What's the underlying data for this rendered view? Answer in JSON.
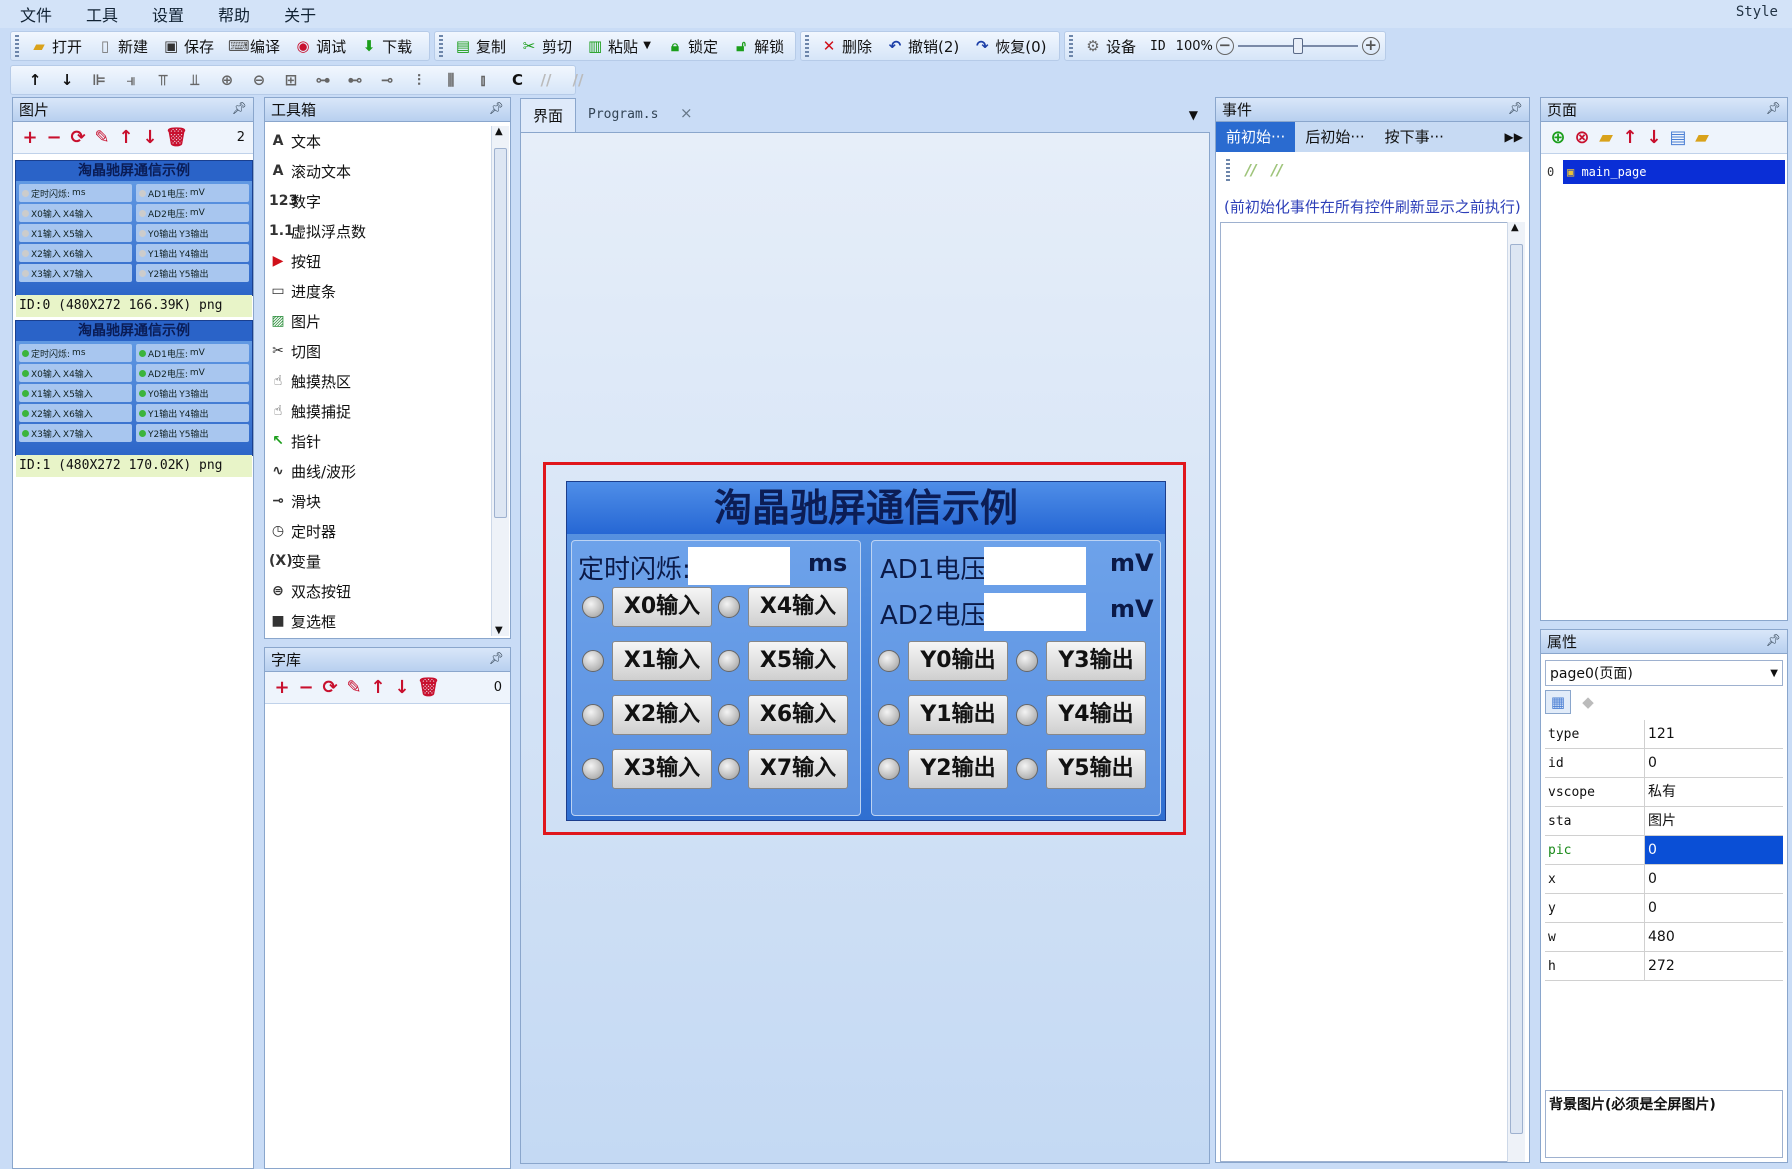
{
  "menu": {
    "items": [
      "文件",
      "工具",
      "设置",
      "帮助",
      "关于"
    ],
    "style": "Style"
  },
  "toolbar1": {
    "file": [
      {
        "icon": "open-folder-icon",
        "label": "打开"
      },
      {
        "icon": "new-file-icon",
        "label": "新建"
      },
      {
        "icon": "save-icon",
        "label": "保存"
      },
      {
        "icon": "compile-icon",
        "label": "编译"
      },
      {
        "icon": "debug-icon",
        "label": "调试"
      },
      {
        "icon": "download-icon",
        "label": "下载"
      }
    ],
    "edit": [
      {
        "icon": "copy-icon",
        "label": "复制"
      },
      {
        "icon": "cut-icon",
        "label": "剪切"
      },
      {
        "icon": "paste-icon",
        "label": "粘贴"
      },
      {
        "icon": "lock-icon",
        "label": "锁定"
      },
      {
        "icon": "unlock-icon",
        "label": "解锁"
      }
    ],
    "history": [
      {
        "icon": "delete-icon",
        "label": "删除"
      },
      {
        "icon": "undo-icon",
        "label": "撤销(2)"
      },
      {
        "icon": "redo-icon",
        "label": "恢复(0)"
      }
    ],
    "device_label": "设备",
    "id_label": "ID",
    "zoom": "100%",
    "zoom_level": 0.5
  },
  "toolbar2": {
    "extra": "C"
  },
  "pictures_panel": {
    "title": "图片",
    "count": "2",
    "items": [
      {
        "title": "淘晶驰屏通信示例",
        "info": "ID:0  (480X272 166.39K) png",
        "active": false
      },
      {
        "title": "淘晶驰屏通信示例",
        "info": "ID:1  (480X272 170.02K) png",
        "active": true
      }
    ],
    "mini_labels": [
      "定时闪烁:",
      "ms",
      "AD1电压:",
      "mV",
      "X0输入",
      "X4输入",
      "AD2电压:",
      "mV",
      "X1输入",
      "X5输入",
      "Y0输出",
      "Y3输出",
      "X2输入",
      "X6输入",
      "Y1输出",
      "Y4输出",
      "X3输入",
      "X7输入",
      "Y2输出",
      "Y5输出"
    ]
  },
  "toolbox": {
    "title": "工具箱",
    "items": [
      {
        "icon": "text-icon",
        "glyph": "A",
        "label": "文本"
      },
      {
        "icon": "scroll-text-icon",
        "glyph": "A",
        "label": "滚动文本"
      },
      {
        "icon": "number-icon",
        "glyph": "123",
        "label": "数字"
      },
      {
        "icon": "float-icon",
        "glyph": "1.1",
        "label": "虚拟浮点数"
      },
      {
        "icon": "button-icon",
        "glyph": "▶",
        "label": "按钮"
      },
      {
        "icon": "progress-icon",
        "glyph": "▭",
        "label": "进度条"
      },
      {
        "icon": "picture-icon",
        "glyph": "▨",
        "label": "图片"
      },
      {
        "icon": "crop-icon",
        "glyph": "✂",
        "label": "切图"
      },
      {
        "icon": "hotspot-icon",
        "glyph": "☝",
        "label": "触摸热区"
      },
      {
        "icon": "touch-capture-icon",
        "glyph": "☝",
        "label": "触摸捕捉"
      },
      {
        "icon": "pointer-icon",
        "glyph": "↖",
        "label": "指针"
      },
      {
        "icon": "waveform-icon",
        "glyph": "∿",
        "label": "曲线/波形"
      },
      {
        "icon": "slider-icon",
        "glyph": "⊸",
        "label": "滑块"
      },
      {
        "icon": "timer-icon",
        "glyph": "◷",
        "label": "定时器"
      },
      {
        "icon": "variable-icon",
        "glyph": "(X)",
        "label": "变量"
      },
      {
        "icon": "dual-state-icon",
        "glyph": "⊜",
        "label": "双态按钮"
      },
      {
        "icon": "checkbox-icon",
        "glyph": "■",
        "label": "复选框"
      }
    ]
  },
  "fonts_panel": {
    "title": "字库",
    "count": "0"
  },
  "editor": {
    "tabs": [
      "界面",
      "Program.s"
    ],
    "close": "×",
    "hmi": {
      "title": "淘晶驰屏通信示例",
      "blink_label": "定时闪烁:",
      "blink_unit": "ms",
      "ad1_label": "AD1电压:",
      "ad2_label": "AD2电压:",
      "volt_unit": "mV",
      "inputs": [
        "X0输入",
        "X4输入",
        "X1输入",
        "X5输入",
        "X2输入",
        "X6输入",
        "X3输入",
        "X7输入"
      ],
      "outputs": [
        "Y0输出",
        "Y3输出",
        "Y1输出",
        "Y4输出",
        "Y2输出",
        "Y5输出"
      ]
    }
  },
  "events_panel": {
    "title": "事件",
    "tabs": [
      "前初始···",
      "后初始···",
      "按下事···"
    ],
    "note": "(前初始化事件在所有控件刷新显示之前执行)"
  },
  "pages_panel": {
    "title": "页面",
    "index": "0",
    "page": "main_page"
  },
  "props_panel": {
    "title": "属性",
    "selector": "page0(页面)",
    "rows": [
      {
        "k": "type",
        "v": "121"
      },
      {
        "k": "id",
        "v": "0"
      },
      {
        "k": "vscope",
        "v": "私有"
      },
      {
        "k": "sta",
        "v": "图片"
      },
      {
        "k": "pic",
        "v": "0"
      },
      {
        "k": "x",
        "v": "0"
      },
      {
        "k": "y",
        "v": "0"
      },
      {
        "k": "w",
        "v": "480"
      },
      {
        "k": "h",
        "v": "272"
      }
    ],
    "desc": "背景图片(必须是全屏图片)"
  }
}
